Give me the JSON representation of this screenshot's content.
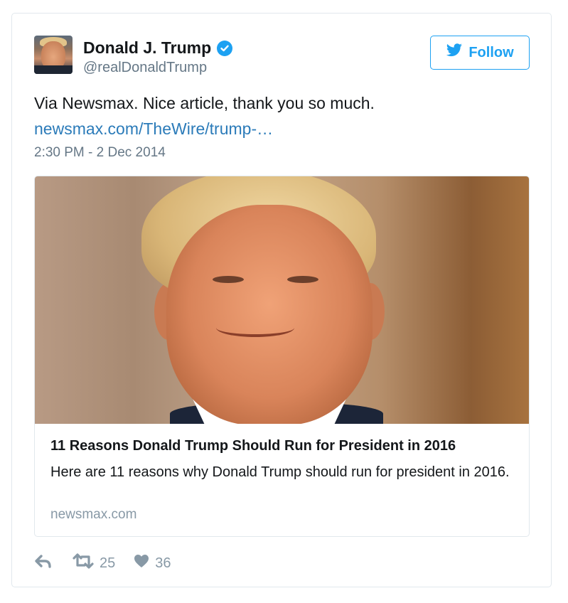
{
  "tweet": {
    "author_name": "Donald J. Trump",
    "author_handle": "@realDonaldTrump",
    "follow_label": "Follow",
    "text": "Via Newsmax. Nice article, thank you so much.",
    "link_text": "newsmax.com/TheWire/trump-…",
    "timestamp": "2:30 PM - 2 Dec 2014"
  },
  "card": {
    "title": "11 Reasons Donald Trump Should Run for President in 2016",
    "description": "Here are 11 reasons why Donald Trump should run for president in 2016.",
    "domain": "newsmax.com"
  },
  "actions": {
    "retweets": "25",
    "likes": "36"
  },
  "icons": [
    "verified-icon",
    "twitter-bird-icon",
    "reply-icon",
    "retweet-icon",
    "heart-icon"
  ],
  "colors": {
    "accent": "#1da1f2",
    "link": "#2b7bb9",
    "muted": "#657786",
    "border": "#e1e8ed"
  }
}
